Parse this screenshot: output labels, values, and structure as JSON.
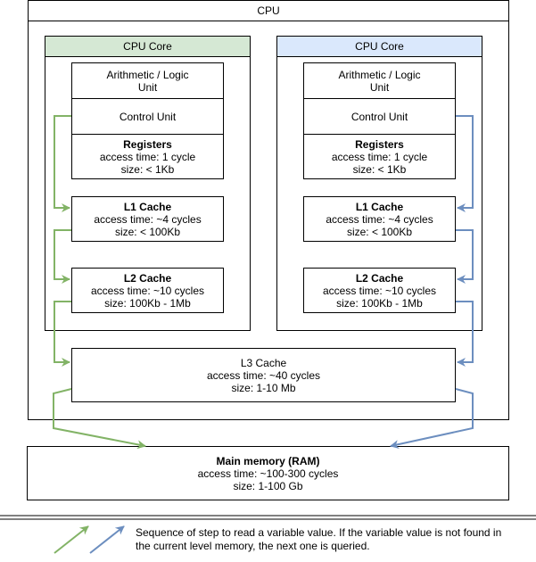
{
  "cpu": {
    "title": "CPU",
    "cores": [
      {
        "title": "CPU Core",
        "header_color": "#d5e8d4",
        "arrow_color": "#82b366",
        "alu": "Arithmetic / Logic Unit",
        "alu_line1": "Arithmetic / Logic",
        "alu_line2": "Unit",
        "control_unit": "Control Unit",
        "registers": {
          "name": "Registers",
          "access": "access time: 1 cycle",
          "size": "size: < 1Kb"
        },
        "l1": {
          "name": "L1 Cache",
          "access": "access time: ~4 cycles",
          "size": "size: < 100Kb"
        },
        "l2": {
          "name": "L2 Cache",
          "access": "access time: ~10 cycles",
          "size": "size: 100Kb - 1Mb"
        }
      },
      {
        "title": "CPU Core",
        "header_color": "#dae8fc",
        "arrow_color": "#6c8ebf",
        "alu": "Arithmetic / Logic Unit",
        "alu_line1": "Arithmetic / Logic",
        "alu_line2": "Unit",
        "control_unit": "Control Unit",
        "registers": {
          "name": "Registers",
          "access": "access time: 1 cycle",
          "size": "size: < 1Kb"
        },
        "l1": {
          "name": "L1 Cache",
          "access": "access time: ~4 cycles",
          "size": "size: < 100Kb"
        },
        "l2": {
          "name": "L2 Cache",
          "access": "access time: ~10 cycles",
          "size": "size: 100Kb - 1Mb"
        }
      }
    ],
    "l3": {
      "name": "L3 Cache",
      "access": "access time: ~40 cycles",
      "size": "size: 1-10 Mb"
    }
  },
  "ram": {
    "name": "Main memory (RAM)",
    "access": "access time: ~100-300 cycles",
    "size": "size: 1-100 Gb"
  },
  "legend": {
    "text": "Sequence of step to read a variable value. If the variable value is not found in the current level memory, the next one is queried.",
    "arrow_colors": [
      "#82b366",
      "#6c8ebf"
    ]
  }
}
